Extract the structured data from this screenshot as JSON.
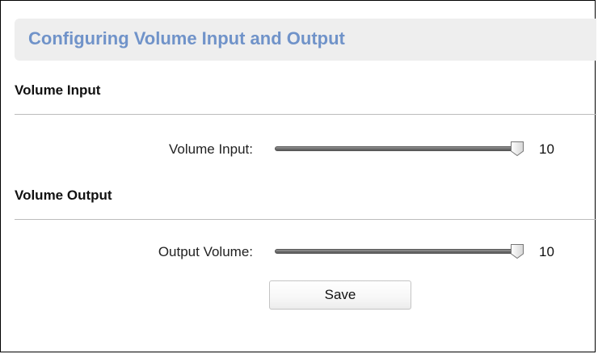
{
  "header": {
    "title": "Configuring Volume Input and Output"
  },
  "sections": {
    "input": {
      "title": "Volume Input",
      "label": "Volume Input:",
      "value": "10",
      "level": 10,
      "max": 10
    },
    "output": {
      "title": "Volume Output",
      "label": "Output Volume:",
      "value": "10",
      "level": 10,
      "max": 10
    }
  },
  "actions": {
    "save_label": "Save"
  }
}
